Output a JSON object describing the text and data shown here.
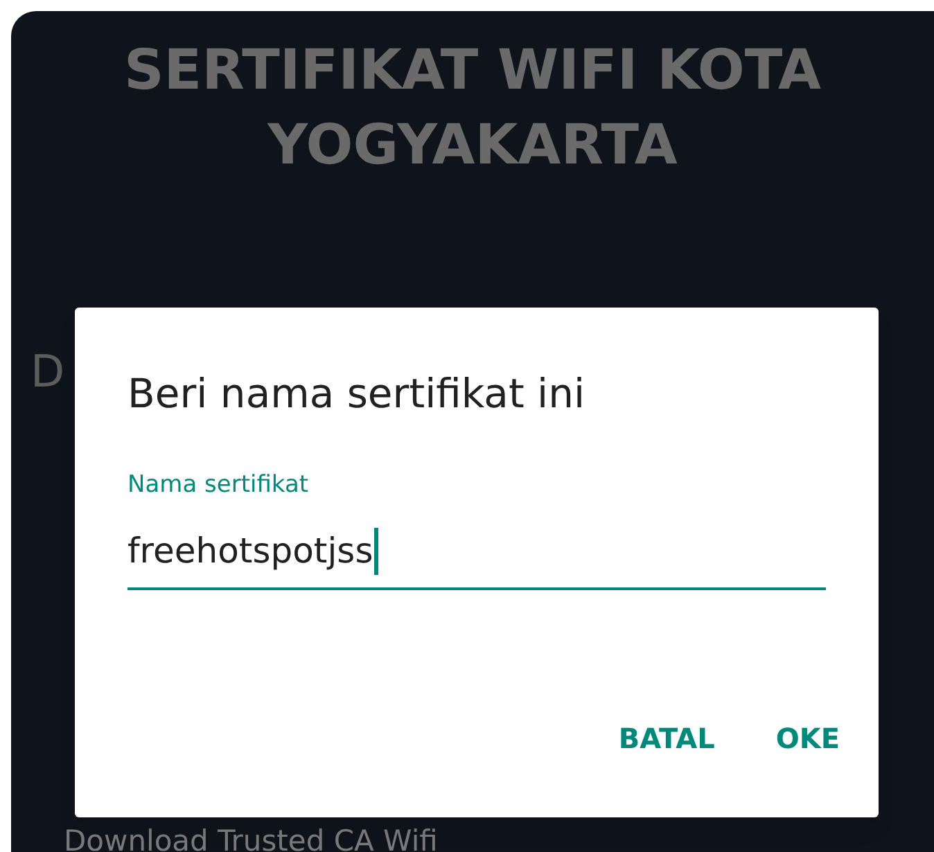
{
  "page": {
    "title": "SERTIFIKAT WIFI KOTA YOGYAKARTA",
    "partial_text": "D",
    "bottom_text": "Download Trusted CA Wifi"
  },
  "dialog": {
    "title": "Beri nama sertifikat ini",
    "field": {
      "label": "Nama sertifikat",
      "value": "freehotspotjss",
      "focused": true
    },
    "buttons": [
      "BATAL",
      "OKE"
    ]
  }
}
